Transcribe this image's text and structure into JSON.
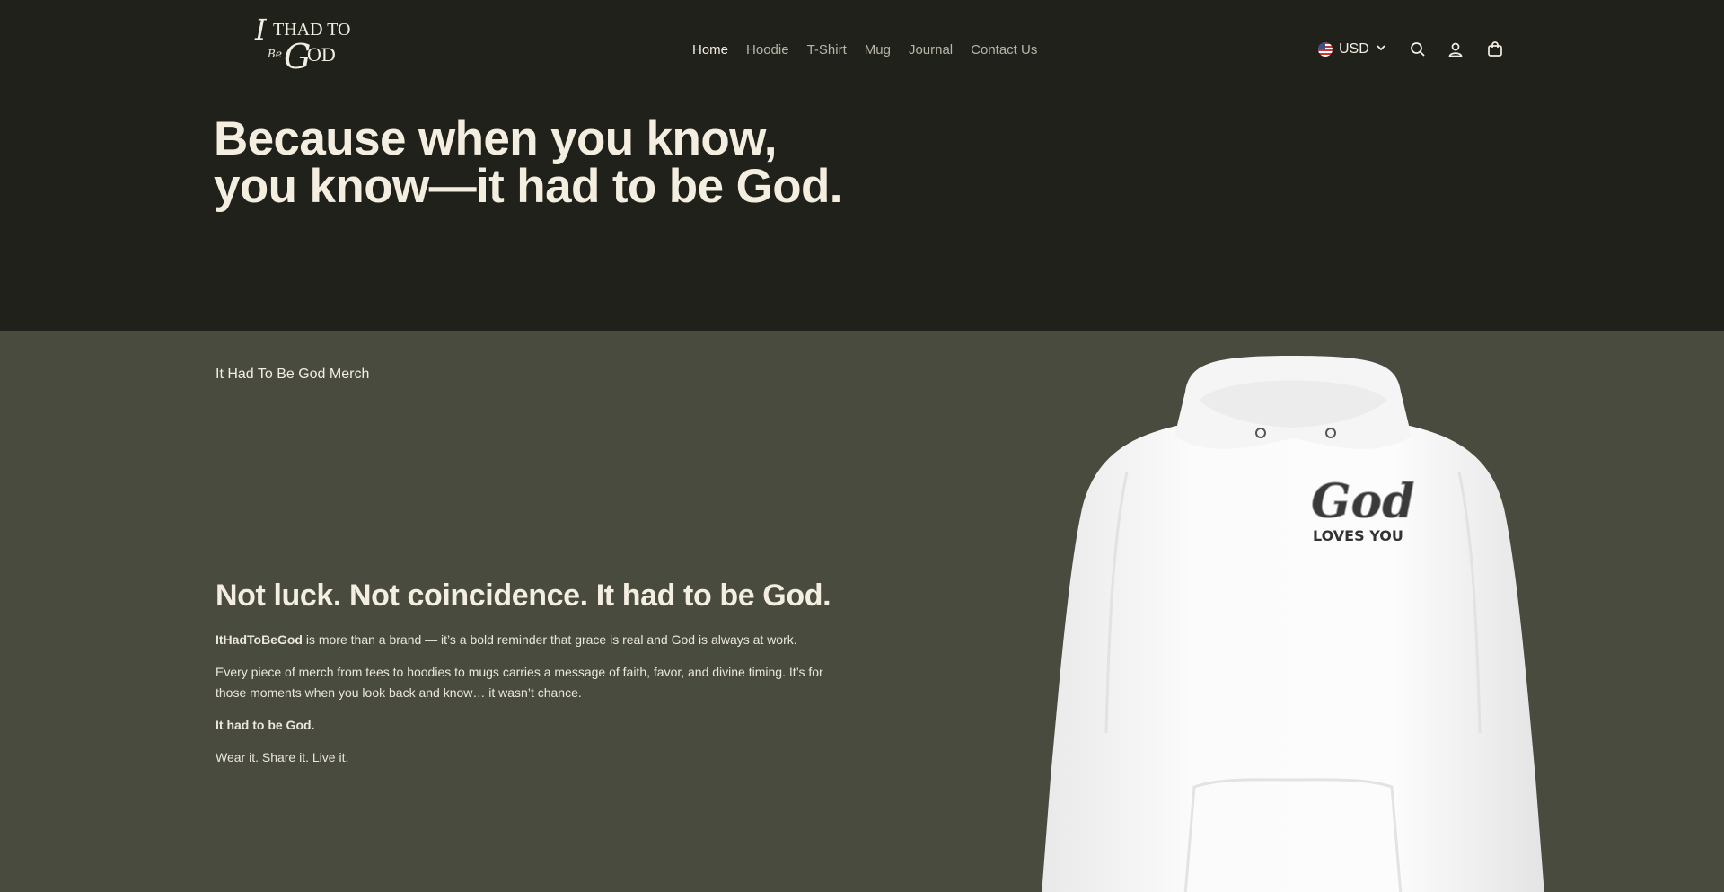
{
  "header": {
    "logo_text": "It Had To Be God",
    "nav": [
      {
        "label": "Home",
        "active": true
      },
      {
        "label": "Hoodie",
        "active": false
      },
      {
        "label": "T-Shirt",
        "active": false
      },
      {
        "label": "Mug",
        "active": false
      },
      {
        "label": "Journal",
        "active": false
      },
      {
        "label": "Contact Us",
        "active": false
      }
    ],
    "currency": "USD",
    "icons": [
      "us-flag-icon",
      "chevron-down-icon",
      "search-icon",
      "account-icon",
      "cart-icon"
    ]
  },
  "hero": {
    "line1": "Because when you know,",
    "line2": "you know—it had to be God."
  },
  "about": {
    "eyebrow": "It Had To Be God Merch",
    "heading": "Not luck. Not coincidence. It had to be God.",
    "p1_bold": "ItHadToBeGod",
    "p1_rest": " is more than a brand — it’s a bold reminder that grace is real and God is always at work.",
    "p2": "Every piece of merch from tees to hoodies to mugs carries a message of faith, favor, and divine timing. It’s for those moments when you look back and know… it wasn’t chance.",
    "p3": "It had to be God.",
    "p4": "Wear it. Share it. Live it."
  },
  "product_image": {
    "print_line1": "God",
    "print_line2": "LOVES YOU"
  },
  "colors": {
    "header_bg": "#20211b",
    "section_bg": "#484b3d",
    "text": "#f3eee2",
    "nav_muted": "#b8b4a8"
  }
}
